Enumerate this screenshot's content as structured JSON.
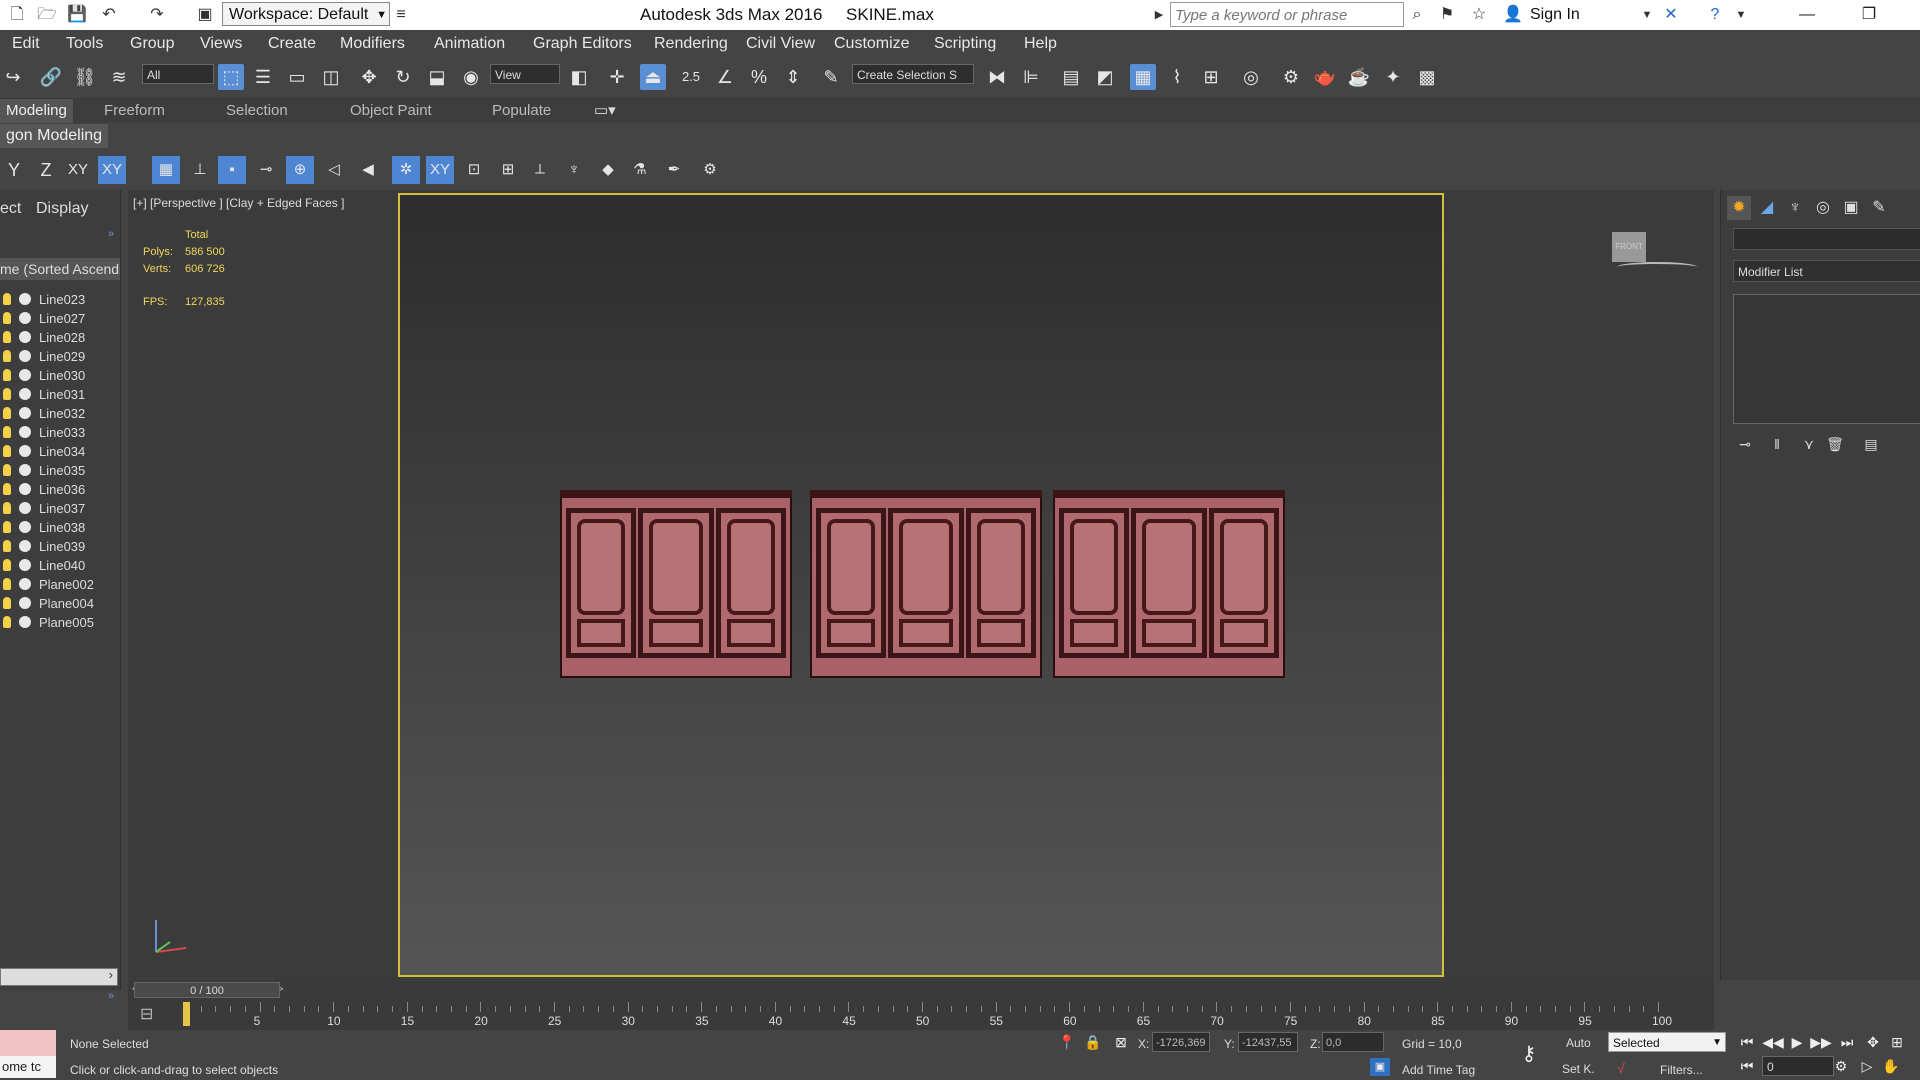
{
  "titlebar": {
    "workspace": "Workspace: Default",
    "app_title": "Autodesk 3ds Max 2016",
    "file_name": "SKINE.max",
    "search_placeholder": "Type a keyword or phrase",
    "signin": "Sign In"
  },
  "menu": [
    "Edit",
    "Tools",
    "Group",
    "Views",
    "Create",
    "Modifiers",
    "Animation",
    "Graph Editors",
    "Rendering",
    "Civil View",
    "Customize",
    "Scripting",
    "Help"
  ],
  "toolbar": {
    "selection_filter": "All",
    "ref_coord": "View",
    "selection_set": "Create Selection S",
    "snap_25": "2.5"
  },
  "ribbon": {
    "tabs": [
      "Modeling",
      "Freeform",
      "Selection",
      "Object Paint",
      "Populate"
    ],
    "active_label": "gon Modeling"
  },
  "snapbar": {
    "y": "Y",
    "z": "Z",
    "xy": "XY",
    "xy_on": "XY",
    "xy2": "XY"
  },
  "explorer": {
    "tabs": [
      "ect",
      "Display"
    ],
    "column_header": "me (Sorted Ascendi",
    "items": [
      "Line023",
      "Line027",
      "Line028",
      "Line029",
      "Line030",
      "Line031",
      "Line032",
      "Line033",
      "Line034",
      "Line035",
      "Line036",
      "Line037",
      "Line038",
      "Line039",
      "Line040",
      "Plane002",
      "Plane004",
      "Plane005"
    ]
  },
  "viewport": {
    "label": "[+] [Perspective ] [Clay + Edged Faces ]",
    "stats_total": "Total",
    "polys_label": "Polys:",
    "polys_value": "586 500",
    "verts_label": "Verts:",
    "verts_value": "606 726",
    "fps_label": "FPS:",
    "fps_value": "127,835",
    "viewcube_label": "FRONT"
  },
  "command_panel": {
    "modifier_list": "Modifier List"
  },
  "timeline": {
    "slider_label": "0 / 100",
    "ticks": [
      "5",
      "10",
      "15",
      "20",
      "25",
      "30",
      "35",
      "40",
      "45",
      "50",
      "55",
      "60",
      "65",
      "70",
      "75",
      "80",
      "85",
      "90",
      "95",
      "100"
    ]
  },
  "status": {
    "maxscript": "ome  tc",
    "selection": "None Selected",
    "prompt": "Click or click-and-drag to select objects",
    "x_label": "X:",
    "x_value": "-1726,369",
    "y_label": "Y:",
    "y_value": "-12437,55",
    "z_label": "Z:",
    "z_value": "0,0",
    "grid": "Grid = 10,0",
    "add_time_tag": "Add Time Tag",
    "auto_key": "Auto",
    "set_key": "Set K.",
    "key_mode": "Selected",
    "filters": "Filters...",
    "frame": "0"
  },
  "colors": {
    "viewport_border": "#d6c03a",
    "active_blue": "#5a8fd6",
    "stat_text": "#f0d65a",
    "panel_fill": "#a96368"
  }
}
